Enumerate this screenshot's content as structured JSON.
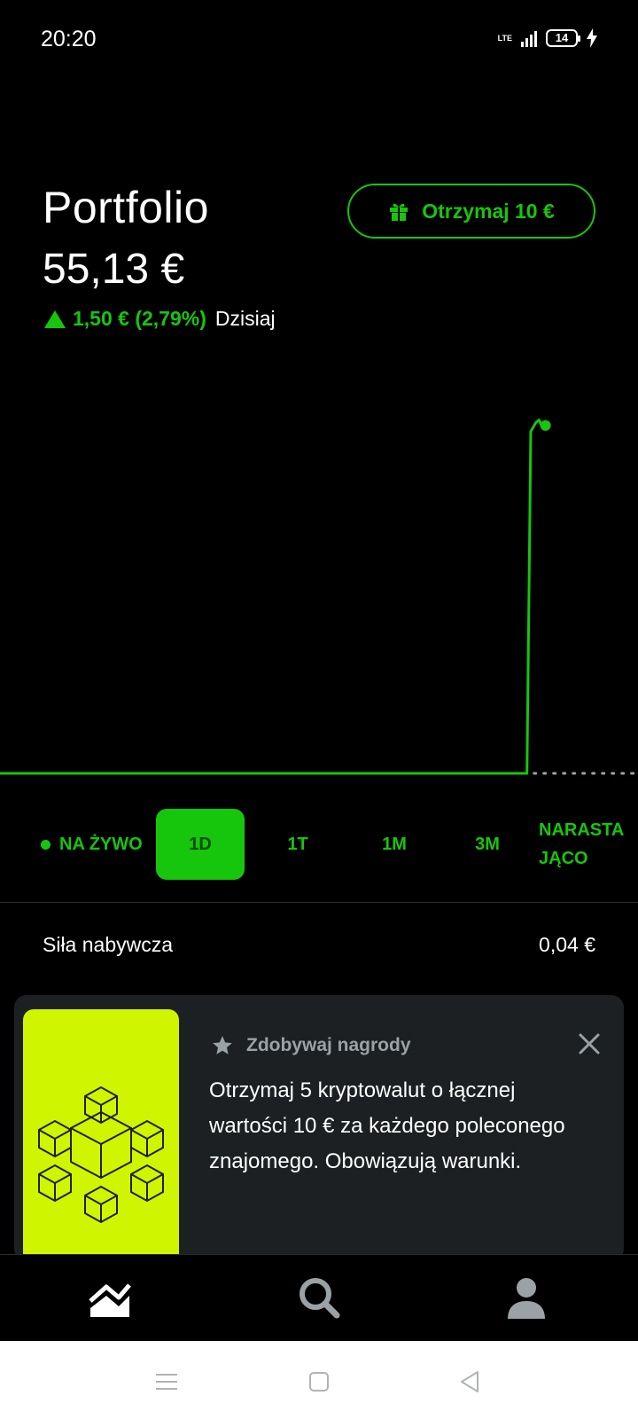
{
  "status_bar": {
    "time": "20:20",
    "network": "LTE",
    "battery": "14"
  },
  "header": {
    "title": "Portfolio",
    "value": "55,13 €",
    "change": "1,50 € (2,79%)",
    "change_period": "Dzisiaj",
    "referral_button": "Otrzymaj 10 €"
  },
  "colors": {
    "accent": "#16c60c",
    "promo_art": "#d0f500",
    "card": "#1d2022",
    "background": "#000000"
  },
  "periods": {
    "live": "NA ŻYWO",
    "items": [
      "1D",
      "1T",
      "1M",
      "3M"
    ],
    "active": "1D",
    "cumulative": "NARASTA\nJĄCO"
  },
  "buying_power": {
    "label": "Siła nabywcza",
    "value": "0,04 €"
  },
  "promo": {
    "heading": "Zdobywaj nagrody",
    "text": "Otrzymaj 5 kryptowalut o łącznej wartości 10 € za każdego poleconego znajomego. Obowiązują warunki."
  },
  "bottom_nav": {
    "items": [
      "portfolio-icon",
      "search-icon",
      "profile-icon"
    ]
  },
  "chart_data": {
    "type": "line",
    "x": [
      0,
      10,
      20,
      30,
      40,
      50,
      60,
      70,
      80,
      82.6,
      83.2,
      84,
      84.5,
      85,
      85.5
    ],
    "values": [
      0,
      0,
      0,
      0,
      0,
      0,
      0,
      0,
      0,
      0,
      54.2,
      55.6,
      56.0,
      54.8,
      55.13
    ],
    "title": "",
    "xlabel": "",
    "ylabel": "",
    "grid": false,
    "legend": "none"
  }
}
